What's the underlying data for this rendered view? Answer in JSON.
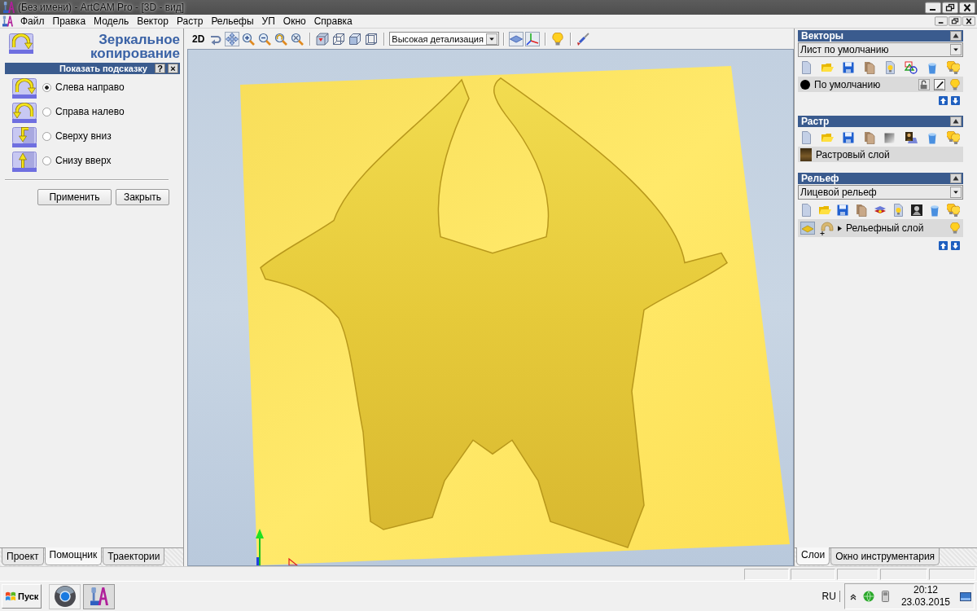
{
  "window": {
    "title": "(Без имени) - ArtCAM Pro - [3D - вид]"
  },
  "menu": [
    "Файл",
    "Правка",
    "Модель",
    "Вектор",
    "Растр",
    "Рельефы",
    "УП",
    "Окно",
    "Справка"
  ],
  "assistant_panel": {
    "title": "Зеркальное копирование",
    "hint_bar": {
      "label": "Показать подсказку",
      "help": "?",
      "close": "×"
    },
    "options": [
      {
        "label": "Слева направо",
        "selected": true
      },
      {
        "label": "Справа налево",
        "selected": false
      },
      {
        "label": "Сверху вниз",
        "selected": false
      },
      {
        "label": "Снизу вверх",
        "selected": false
      }
    ],
    "buttons": [
      "Применить",
      "Закрыть"
    ],
    "tabs": [
      {
        "label": "Проект",
        "selected": false
      },
      {
        "label": "Помощник",
        "selected": true
      },
      {
        "label": "Траектории",
        "selected": false
      }
    ]
  },
  "toolbar": {
    "view_mode": "2D",
    "view_tools": [
      {
        "pressed": false
      },
      {
        "pressed": true
      },
      {
        "pressed": false
      },
      {
        "pressed": false
      },
      {
        "pressed": false
      },
      {
        "pressed": false
      }
    ],
    "cube_tools": [
      {
        "pressed": false
      },
      {
        "pressed": false
      },
      {
        "pressed": false
      },
      {
        "pressed": false
      }
    ],
    "detail_select": {
      "value": "Высокая детализация"
    },
    "display_tools": [
      {
        "pressed": true
      },
      {
        "pressed": true
      }
    ],
    "light_tools": [
      {
        "pressed": false
      }
    ],
    "material_tools": [
      {
        "pressed": false
      }
    ]
  },
  "layers_panel": {
    "sections": [
      {
        "kind": "vectors",
        "title": "Векторы",
        "select": {
          "value": "Лист по умолчанию"
        },
        "layers": [
          {
            "name": "По умолчанию",
            "color": "#000000",
            "visible": true
          }
        ]
      },
      {
        "kind": "raster",
        "title": "Растр",
        "layers": [
          {
            "name": "Растровый слой"
          }
        ]
      },
      {
        "kind": "relief",
        "title": "Рельеф",
        "select": {
          "value": "Лицевой рельеф"
        },
        "layers": [
          {
            "name": "Рельефный слой",
            "visible": true,
            "expanded": false
          }
        ]
      }
    ],
    "tabs": [
      {
        "label": "Слои",
        "selected": true
      },
      {
        "label": "Окно инструментария",
        "selected": false
      }
    ]
  },
  "taskbar": {
    "start": "Пуск",
    "apps": [
      {
        "selected": false
      },
      {
        "selected": true
      }
    ],
    "language": "RU",
    "time": "20:12",
    "date": "23.03.2015"
  }
}
